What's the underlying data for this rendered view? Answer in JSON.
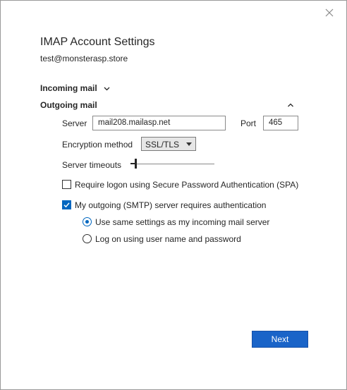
{
  "dialog": {
    "title": "IMAP Account Settings",
    "email": "test@monsterasp.store"
  },
  "sections": {
    "incoming": {
      "label": "Incoming mail",
      "icon": "chevron-down-icon",
      "expanded": false
    },
    "outgoing": {
      "label": "Outgoing mail",
      "icon": "chevron-up-icon",
      "expanded": true
    }
  },
  "outgoing": {
    "server_label": "Server",
    "server_value": "mail208.mailasp.net",
    "port_label": "Port",
    "port_value": "465",
    "encryption_label": "Encryption method",
    "encryption_value": "SSL/TLS",
    "timeout_label": "Server timeouts",
    "timeout_level": 0,
    "spa_label": "Require logon using Secure Password Authentication (SPA)",
    "spa_checked": false,
    "auth_label": "My outgoing (SMTP) server requires authentication",
    "auth_checked": true,
    "auth_options": [
      {
        "label": "Use same settings as my incoming mail server",
        "selected": true
      },
      {
        "label": "Log on using user name and password",
        "selected": false
      }
    ]
  },
  "footer": {
    "next_label": "Next"
  },
  "colors": {
    "accent": "#0067c0",
    "button": "#1a64c8"
  }
}
